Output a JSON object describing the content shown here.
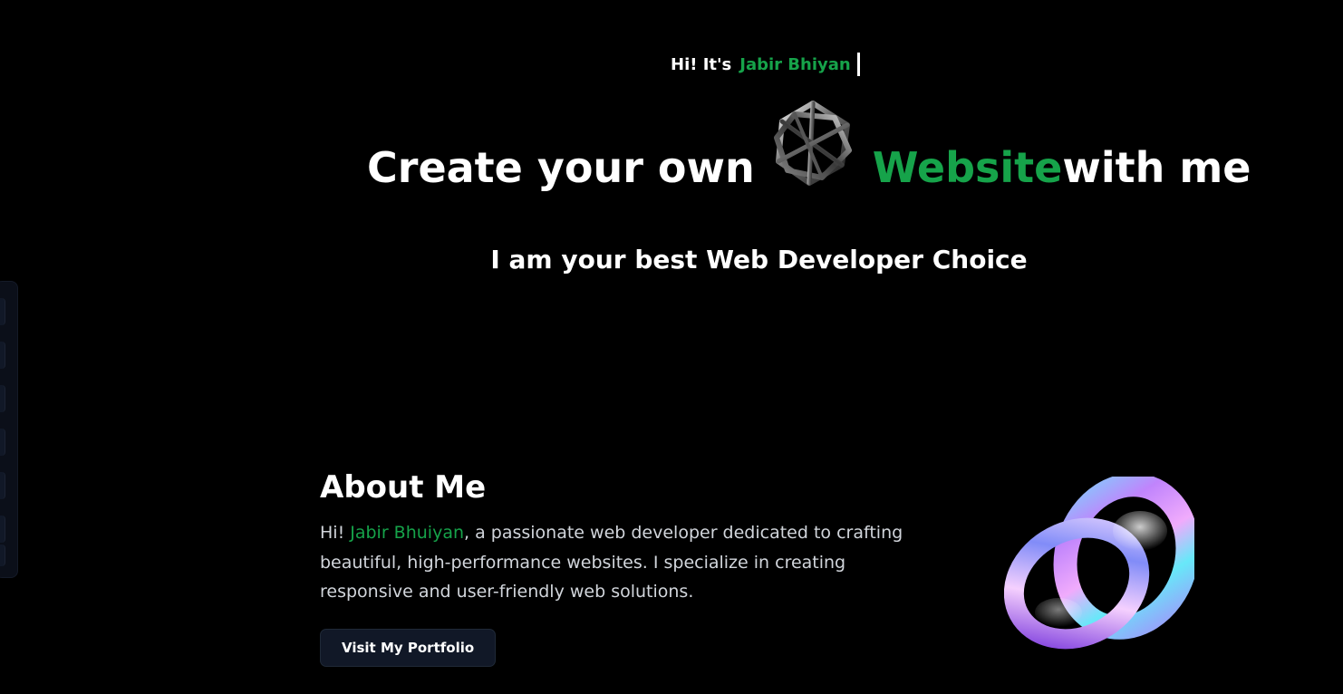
{
  "greeting": {
    "prefix": "Hi! It's",
    "name": "Jabir Bhiyan"
  },
  "hero": {
    "title_part1": "Create your own",
    "title_accent": "Website",
    "title_part2": "with me",
    "subtitle": "I am your best Web Developer Choice",
    "decoration_icon": "wireframe-polyhedron-icon"
  },
  "about": {
    "heading": "About Me",
    "intro_prefix": "Hi! ",
    "name": "Jabir Bhuiyan",
    "intro_suffix": ", a passionate web developer dedicated to crafting beautiful, high-performance websites. I specialize in creating responsive and user-friendly web solutions.",
    "button_label": "Visit My Portfolio",
    "decoration_icon": "iridescent-ring-icon"
  },
  "side_rail": {
    "item_count": 7
  },
  "colors": {
    "background": "#000000",
    "accent": "#16a34a",
    "text": "#ffffff",
    "muted_text": "#d1d5db",
    "button_bg": "#111827"
  }
}
